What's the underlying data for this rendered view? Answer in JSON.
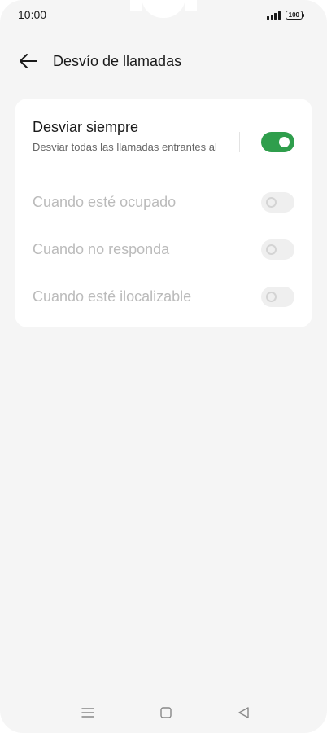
{
  "status_bar": {
    "time": "10:00",
    "battery_level": "100"
  },
  "header": {
    "title": "Desvío de llamadas",
    "back_icon": "arrow-left-icon"
  },
  "forwarding_options": [
    {
      "title": "Desviar siempre",
      "subtitle": "Desviar todas las llamadas entrantes al",
      "enabled": true,
      "switch_on": true
    },
    {
      "title": "Cuando esté ocupado",
      "enabled": false,
      "switch_on": false
    },
    {
      "title": "Cuando no responda",
      "enabled": false,
      "switch_on": false
    },
    {
      "title": "Cuando esté ilocalizable",
      "enabled": false,
      "switch_on": false
    }
  ],
  "navigation_bar": {
    "icons": [
      "menu-icon",
      "home-icon",
      "back-triangle-icon"
    ]
  },
  "colors": {
    "background": "#f5f5f5",
    "card": "#ffffff",
    "switch_on": "#2f9e4c",
    "text_primary": "#1a1a1a",
    "text_disabled": "#bbbbbb"
  }
}
